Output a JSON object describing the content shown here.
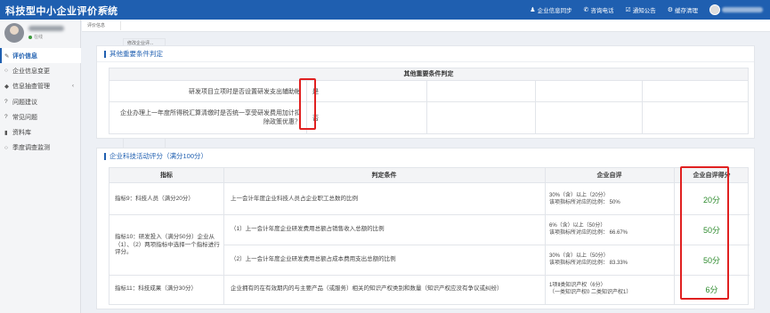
{
  "app": {
    "title": "科技型中小企业评价系统",
    "menu_icon": "≡"
  },
  "topbar": {
    "actions": [
      {
        "icon": "user-icon",
        "glyph": "♟",
        "label": "企业信息同步"
      },
      {
        "icon": "phone-icon",
        "glyph": "✆",
        "label": "咨询电话"
      },
      {
        "icon": "notice-icon",
        "glyph": "☑",
        "label": "通知公告"
      },
      {
        "icon": "cache-icon",
        "glyph": "⚙",
        "label": "缓存清理"
      }
    ]
  },
  "sidebar": {
    "online_label": "在线",
    "items": [
      {
        "label": "评价信息",
        "icon": "edit-icon",
        "glyph": "✎",
        "active": true
      },
      {
        "label": "企业信息变更",
        "icon": "circle-icon",
        "glyph": "○",
        "active": false
      },
      {
        "label": "信息抽查管理",
        "icon": "tag-icon",
        "glyph": "◆",
        "active": false,
        "has_children": true
      },
      {
        "label": "问题建议",
        "icon": "question-icon",
        "glyph": "?",
        "active": false
      },
      {
        "label": "常见问题",
        "icon": "help-icon",
        "glyph": "?",
        "active": false
      },
      {
        "label": "资料库",
        "icon": "library-icon",
        "glyph": "▮",
        "active": false
      },
      {
        "label": "季度调查监测",
        "icon": "survey-icon",
        "glyph": "○",
        "active": false
      }
    ]
  },
  "tabs": [
    {
      "label": "评价信息"
    },
    {
      "label": "修改企业评..."
    }
  ],
  "section1": {
    "title": "其他重要条件判定",
    "table_header": "其他重要条件判定",
    "rows": [
      {
        "label": "研发项目立项时是否设置研发支出辅助帐",
        "answer": "是"
      },
      {
        "label": "企业办理上一年度所得税汇算清缴时是否统一享受研发费用加计扣除政策优惠？",
        "answer": "否"
      }
    ]
  },
  "section2": {
    "title": "企业科技活动评分（满分100分）",
    "headers": {
      "indicator": "指标",
      "condition": "判定条件",
      "self_eval": "企业自评",
      "score": "企业自评得分"
    },
    "rows": [
      {
        "indicator": "指标9：科技人员（满分20分）",
        "condition": "上一会计年度企业科技人员占企业职工总数的比例",
        "self_eval_line1": "30%（含）以上（20分）",
        "self_eval_line2": "该项指标所对应的比例：  50%",
        "score": "20分"
      },
      {
        "indicator": "指标10：研发投入（满分50分）企业从（1）、（2）两项指标中选择一个指标进行评分。",
        "condition": "（1）上一会计年度企业研发费用总额占销售收入总额的比例",
        "self_eval_line1": "6%（含）以上（50分）",
        "self_eval_line2": "该项指标所对应的比例：  66.67%",
        "score": "50分"
      },
      {
        "indicator": "",
        "condition": "（2）上一会计年度企业研发费用总额占成本费用支出总额的比例",
        "self_eval_line1": "30%（含）以上（50分）",
        "self_eval_line2": "该项指标所对应的比例：  83.33%",
        "score": "50分"
      },
      {
        "indicator": "指标11：科技成果（满分30分）",
        "condition": "企业拥有的在有效期内的与主要产品（或服务）相关的知识产权类别和数量（知识产权应没有争议或纠纷）",
        "self_eval_line1": "1项Ⅱ类知识产权（6分）",
        "self_eval_line2": "（一类知识产权0 二类知识产权1）",
        "score": "6分"
      }
    ]
  },
  "colors": {
    "brand": "#1f5fb0",
    "score_green": "#2e8b2e",
    "highlight_red": "#e02020"
  }
}
